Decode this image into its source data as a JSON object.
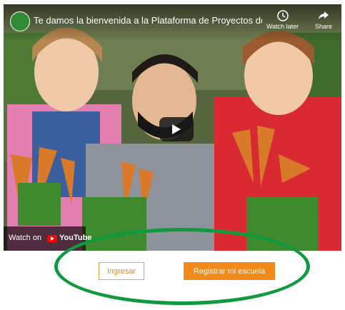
{
  "video": {
    "title": "Te damos la bienvenida a la Plataforma de Proyectos de ...",
    "watch_later_label": "Watch later",
    "share_label": "Share",
    "watch_on_label": "Watch on",
    "youtube_label": "YouTube"
  },
  "actions": {
    "login_label": "Ingresar",
    "register_label": "Registrar mi escuela"
  },
  "colors": {
    "accent_orange": "#f28a1b",
    "highlight_green": "#0e9a3d"
  }
}
